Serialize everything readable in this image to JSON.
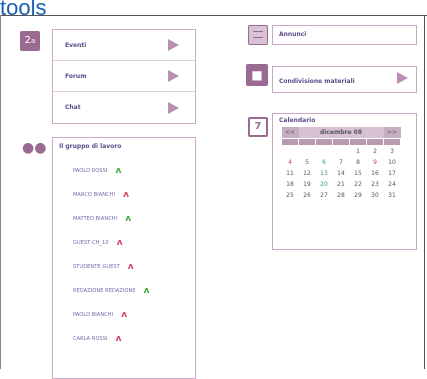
{
  "page": {
    "title": "tools"
  },
  "colors": {
    "accent": "#9b6a93",
    "online": "#3aa83a",
    "offline": "#d04060",
    "title": "#1a5fb4"
  },
  "tools": {
    "items": [
      {
        "label": "Eventi"
      },
      {
        "label": "Forum"
      },
      {
        "label": "Chat"
      }
    ]
  },
  "announcements": {
    "label": "Annunci"
  },
  "materials": {
    "label": "Condivisione materiali"
  },
  "group": {
    "title": "Il gruppo di lavoro",
    "members": [
      {
        "name": "PAOLO ROSSI",
        "status": "online"
      },
      {
        "name": "MARCO BIANCHI",
        "status": "offline"
      },
      {
        "name": "MATTEO BIANCHI",
        "status": "online"
      },
      {
        "name": "GUEST CH_10",
        "status": "offline"
      },
      {
        "name": "STUDENTE GUEST",
        "status": "offline"
      },
      {
        "name": "REDAZIONE REDAZIONE",
        "status": "online"
      },
      {
        "name": "PAOLO BIANCHI",
        "status": "offline"
      },
      {
        "name": "CARLA ROSSI",
        "status": "offline"
      }
    ]
  },
  "calendar": {
    "title": "Calendario",
    "prev": "<<",
    "next": ">>",
    "month_label": "dicembre 08",
    "weeks": [
      [
        "",
        "",
        "",
        "",
        "1",
        "2",
        "3"
      ],
      [
        "4",
        "5",
        "6",
        "7",
        "8",
        "9",
        "10"
      ],
      [
        "11",
        "12",
        "13",
        "14",
        "15",
        "16",
        "17"
      ],
      [
        "18",
        "19",
        "20",
        "21",
        "22",
        "23",
        "24"
      ],
      [
        "25",
        "26",
        "27",
        "28",
        "29",
        "30",
        "31"
      ]
    ],
    "highlighted": [
      "6",
      "13",
      "20"
    ],
    "marked": [
      "4",
      "9"
    ]
  }
}
